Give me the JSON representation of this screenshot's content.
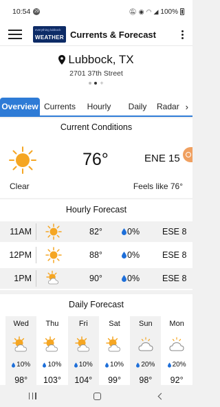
{
  "status_bar": {
    "time": "10:54",
    "badge": "29",
    "battery": "100%"
  },
  "app_bar": {
    "logo_line1": "everything lubbock",
    "logo_line2": "WEATHER",
    "title": "Currents & Forecast"
  },
  "location": {
    "city": "Lubbock, TX",
    "address": "2701 37th Street"
  },
  "tabs": [
    {
      "label": "Overview",
      "active": true
    },
    {
      "label": "Currents"
    },
    {
      "label": "Hourly"
    },
    {
      "label": "Daily"
    },
    {
      "label": "Radar"
    }
  ],
  "current": {
    "title": "Current Conditions",
    "temp": "76°",
    "wind": "ENE 15",
    "condition": "Clear",
    "feels_like": "Feels like 76°",
    "icon": "sun-icon"
  },
  "hourly": {
    "title": "Hourly Forecast",
    "rows": [
      {
        "time": "11AM",
        "temp": "82°",
        "pop": "0%",
        "wind": "ESE  8",
        "icon": "sun-icon"
      },
      {
        "time": "12PM",
        "temp": "88°",
        "pop": "0%",
        "wind": "ESE  8",
        "icon": "sun-icon"
      },
      {
        "time": "1PM",
        "temp": "90°",
        "pop": "0%",
        "wind": "ESE  8",
        "icon": "partly-cloudy-icon"
      }
    ]
  },
  "daily": {
    "title": "Daily Forecast",
    "days": [
      {
        "name": "Wed",
        "pop": "10%",
        "hi": "98°",
        "icon": "partly-cloudy-icon"
      },
      {
        "name": "Thu",
        "pop": "10%",
        "hi": "103°",
        "icon": "partly-cloudy-icon"
      },
      {
        "name": "Fri",
        "pop": "10%",
        "hi": "104°",
        "icon": "partly-cloudy-icon"
      },
      {
        "name": "Sat",
        "pop": "10%",
        "hi": "99°",
        "icon": "partly-cloudy-icon"
      },
      {
        "name": "Sun",
        "pop": "20%",
        "hi": "98°",
        "icon": "cloudy-icon"
      },
      {
        "name": "Mon",
        "pop": "20%",
        "hi": "92°",
        "icon": "cloudy-icon"
      }
    ]
  },
  "colors": {
    "accent": "#2e7bd6",
    "sun": "#f5a623",
    "drop": "#1e6fd9",
    "header_logo": "#0d2b66"
  }
}
